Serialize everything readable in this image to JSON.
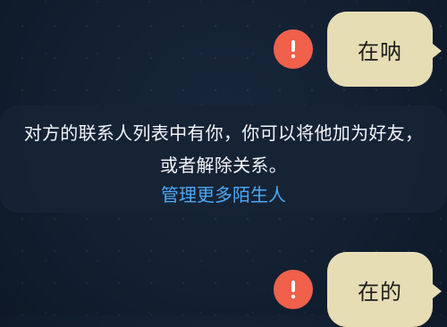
{
  "chat": {
    "messages": [
      {
        "text": "在呐",
        "status_icon": "error-icon"
      },
      {
        "text": "在的",
        "status_icon": "error-icon"
      }
    ],
    "system_notice": {
      "text": "对方的联系人列表中有你，你可以将他加为好友，或者解除关系。",
      "link_text": "管理更多陌生人"
    }
  },
  "theme": {
    "background": "#122031",
    "bubble": "#e6ddb4",
    "error": "#f0604b",
    "link": "#4da8f4",
    "notice_text": "#f3f6fb"
  }
}
